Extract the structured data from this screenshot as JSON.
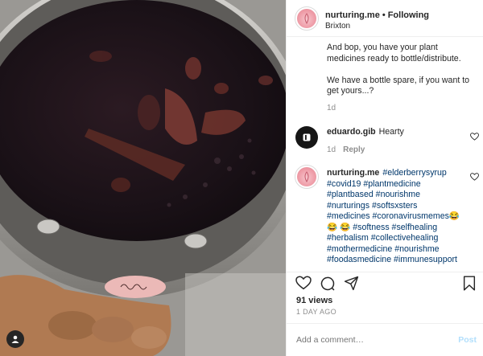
{
  "post": {
    "username": "nurturing.me",
    "separator": "•",
    "follow_state": "Following",
    "location": "Brixton"
  },
  "media": {
    "overlay_text": "me"
  },
  "caption": {
    "lines": [
      "And bop, you have your plant",
      "medicines ready to bottle/distribute.",
      "",
      "We have a bottle spare, if you want to",
      "get yours...?"
    ],
    "time": "1d"
  },
  "comments": [
    {
      "username": "eduardo.gib",
      "text": "Hearty",
      "time": "1d",
      "reply_label": "Reply"
    },
    {
      "username": "nurturing.me",
      "tags": [
        "#elderberrysyrup",
        "#covid19 #plantmedicine",
        "#plantbased #nourishme",
        "#nurturings #softsxsters",
        "#medicines #coronavirusmemes😂",
        "😂 😂 #softness #selfhealing",
        "#herbalism #collectivehealing",
        "#mothermedicine #nourishme",
        "#foodasmedicine #immunesupport"
      ]
    }
  ],
  "engagement": {
    "views": "91 views",
    "date": "1 DAY AGO"
  },
  "add_comment": {
    "placeholder": "Add a comment…",
    "post_label": "Post"
  },
  "icons": {
    "like": "heart-icon",
    "comment": "comment-icon",
    "share": "share-icon",
    "save": "bookmark-icon",
    "tagged": "user-tag-icon"
  },
  "colors": {
    "link": "#00376b",
    "muted": "#8e8e8e",
    "post_disabled": "#b2dffc",
    "avatar_pink": "#ee9ba6"
  }
}
